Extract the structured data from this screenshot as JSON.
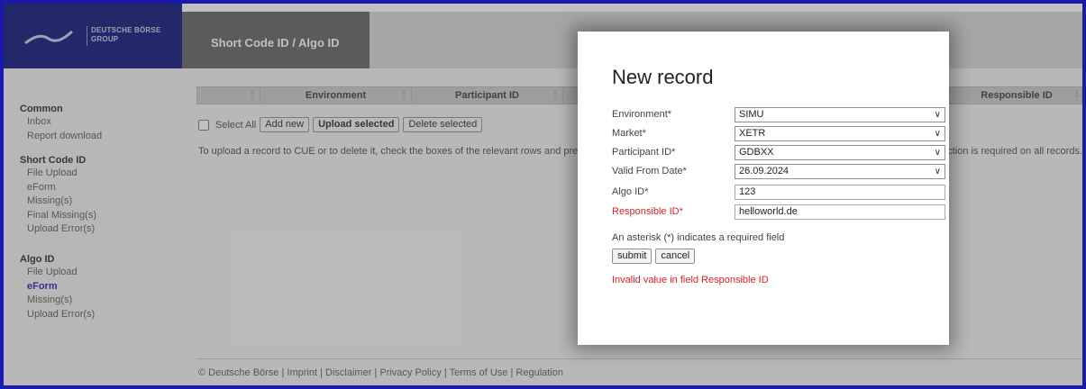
{
  "header": {
    "logo_line1": "DEUTSCHE BÖRSE",
    "logo_line2": "GROUP",
    "title": "Short Code ID / Algo ID"
  },
  "sidebar": {
    "groups": [
      {
        "title": "Common",
        "items": [
          "Inbox",
          "Report download"
        ]
      },
      {
        "title": "Short Code ID",
        "items": [
          "File Upload",
          "eForm",
          "Missing(s)",
          "Final Missing(s)",
          "Upload Error(s)"
        ]
      },
      {
        "title": "Algo ID",
        "items": [
          "File Upload",
          "eForm",
          "Missing(s)",
          "Upload Error(s)"
        ]
      }
    ],
    "active": "eForm"
  },
  "table": {
    "columns": [
      "Environment",
      "Participant ID",
      "Responsible ID"
    ]
  },
  "actions": {
    "select_all": "Select All",
    "add_new": "Add new",
    "upload_selected": "Upload selected",
    "delete_selected": "Delete selected"
  },
  "info": {
    "left": "To upload a record to CUE or to delete it, check the boxes of the relevant rows and pres",
    "right": "ction is required on all records."
  },
  "footer": {
    "copyright": "© Deutsche Börse",
    "links": [
      "Imprint",
      "Disclaimer",
      "Privacy Policy",
      "Terms of Use",
      "Regulation"
    ]
  },
  "modal": {
    "title": "New record",
    "fields": {
      "environment": {
        "label": "Environment*",
        "value": "SIMU"
      },
      "market": {
        "label": "Market*",
        "value": "XETR"
      },
      "participant_id": {
        "label": "Participant ID*",
        "value": "GDBXX"
      },
      "valid_from": {
        "label": "Valid From Date*",
        "value": "26.09.2024"
      },
      "algo_id": {
        "label": "Algo ID*",
        "value": "123"
      },
      "responsible_id": {
        "label": "Responsible ID*",
        "value": "helloworld.de"
      }
    },
    "required_note": "An asterisk (*) indicates a required field",
    "submit": "submit",
    "cancel": "cancel",
    "error": "Invalid value in field Responsible ID"
  },
  "colors": {
    "brand_navy": "#000a73",
    "frame_blue": "#1a1aa8",
    "error_red": "#dd2222"
  }
}
